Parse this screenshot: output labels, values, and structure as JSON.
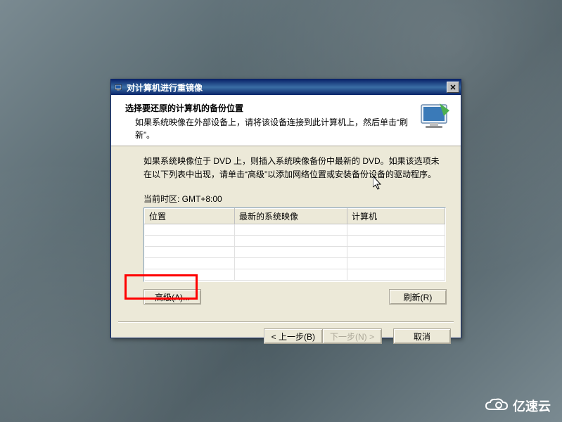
{
  "dialog": {
    "title": "对计算机进行重镜像",
    "header_title": "选择要还原的计算机的备份位置",
    "header_sub": "如果系统映像在外部设备上，请将该设备连接到此计算机上，然后单击“刷新”。",
    "instruction": "如果系统映像位于 DVD 上，则插入系统映像备份中最新的 DVD。如果该选项未在以下列表中出现，请单击“高级”以添加网络位置或安装备份设备的驱动程序。",
    "timezone_label": "当前时区: GMT+8:00",
    "columns": {
      "location": "位置",
      "latest": "最新的系统映像",
      "computer": "计算机"
    },
    "buttons": {
      "advanced": "高级(A)...",
      "refresh": "刷新(R)",
      "back": "< 上一步(B)",
      "next": "下一步(N) >",
      "cancel": "取消"
    }
  },
  "logo": {
    "text": "亿速云"
  }
}
